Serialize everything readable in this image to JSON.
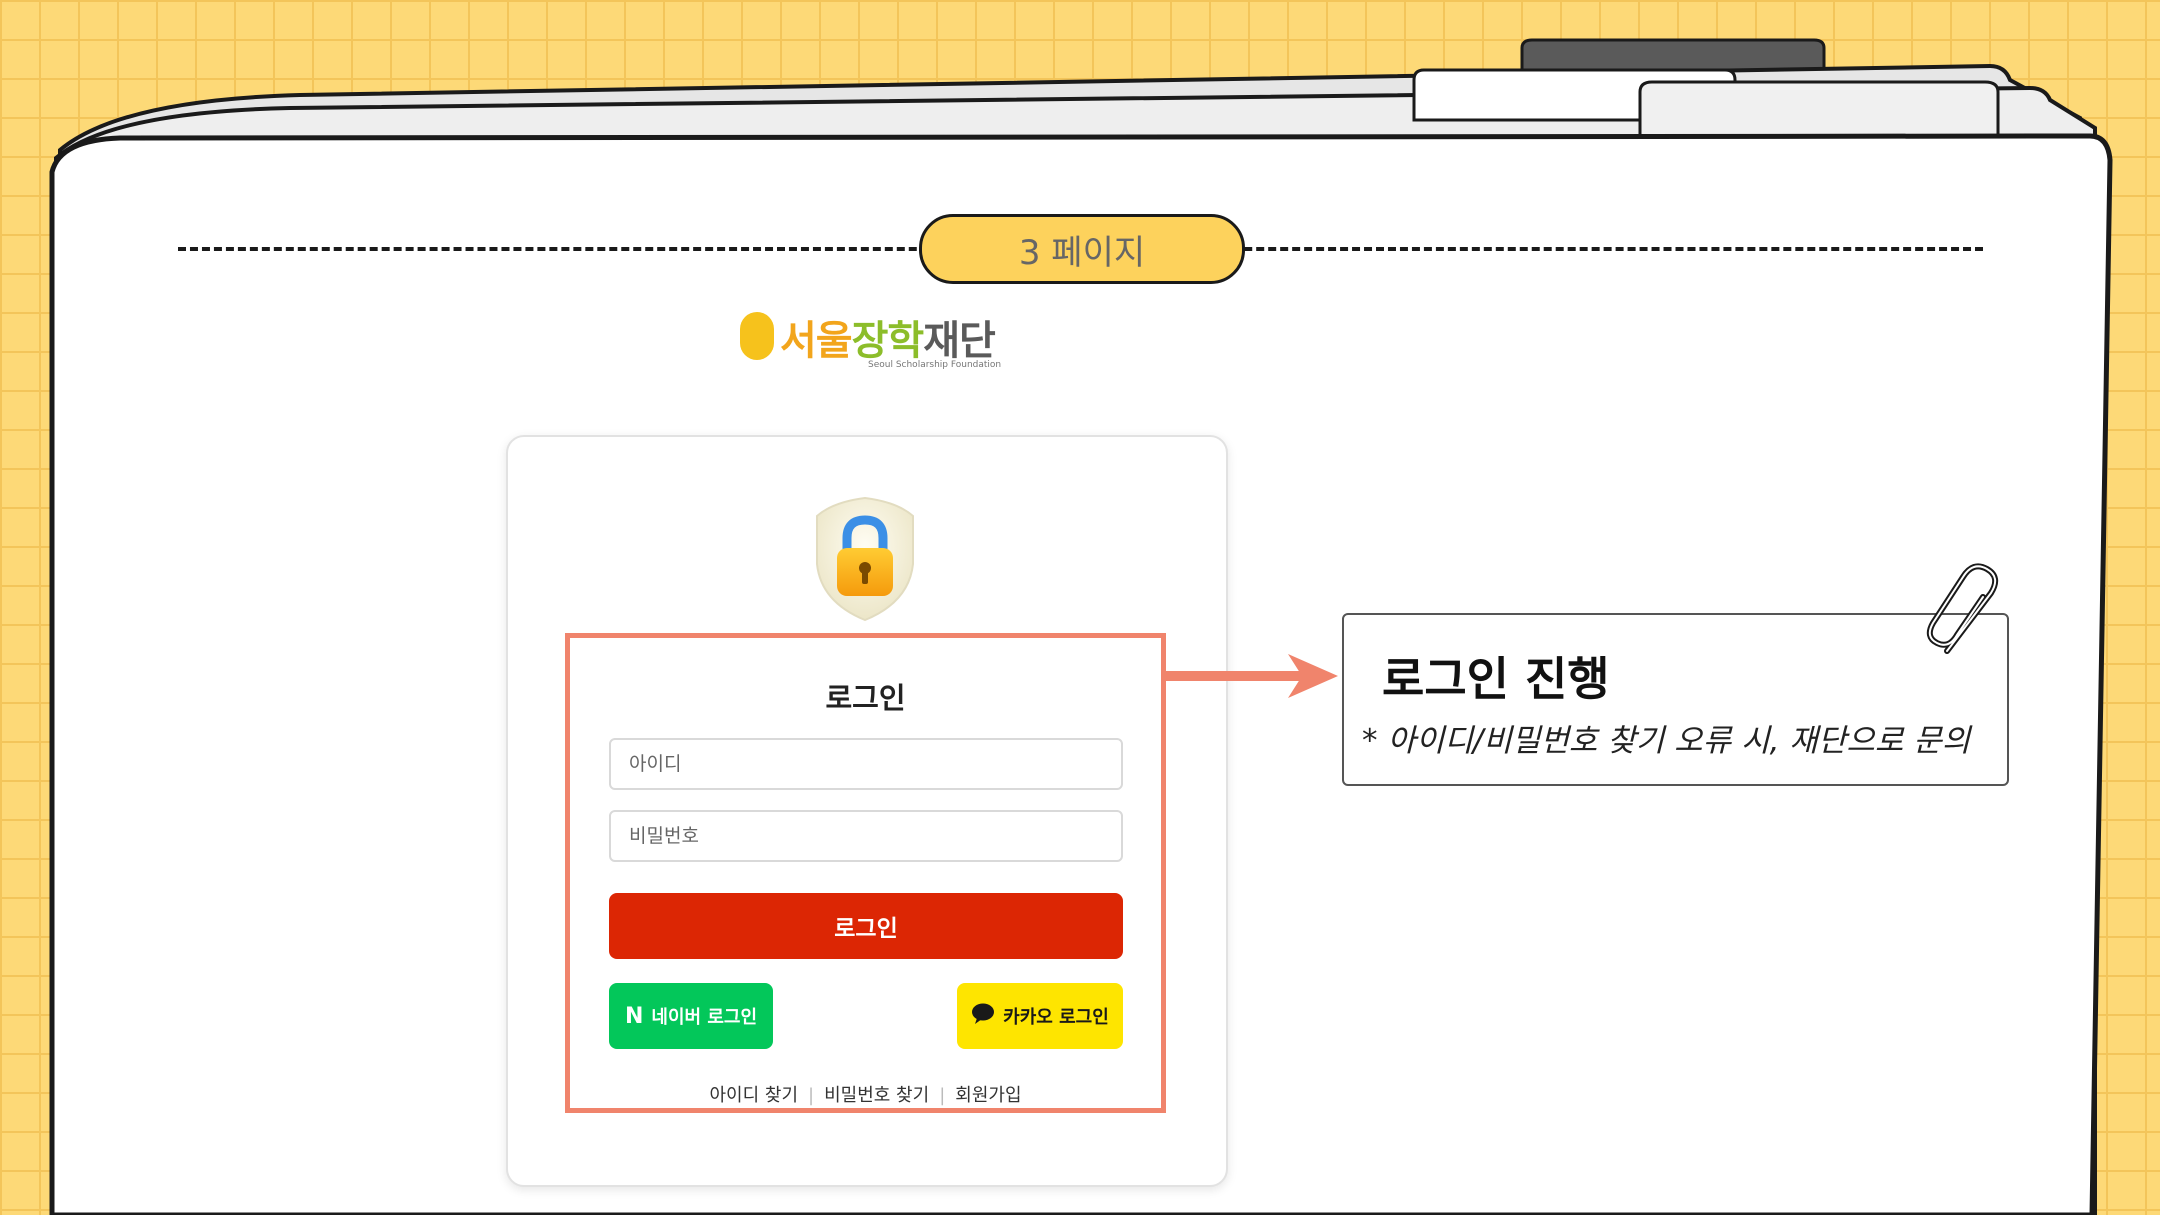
{
  "page_indicator": {
    "label": "3 페이지"
  },
  "logo": {
    "part1": "서울",
    "part2": "장학",
    "part3": "재단",
    "subtitle": "Seoul Scholarship Foundation"
  },
  "login_form": {
    "title": "로그인",
    "id_placeholder": "아이디",
    "password_placeholder": "비밀번호",
    "login_button": "로그인",
    "naver_mark": "N",
    "naver_button": "네이버 로그인",
    "kakao_button": "카카오 로그인",
    "links": {
      "find_id": "아이디 찾기",
      "find_password": "비밀번호 찾기",
      "signup": "회원가입"
    }
  },
  "annotation": {
    "title": "로그인 진행",
    "note": "* 아이디/비밀번호 찾기 오류 시, 재단으로 문의"
  },
  "colors": {
    "background": "#fdd977",
    "highlight": "#f0846c",
    "login_button": "#dc2604",
    "naver": "#03c75a",
    "kakao": "#fee500",
    "pill": "#fdd25c"
  },
  "icons": [
    "lock-icon",
    "naver-logo-icon",
    "kakao-chat-icon",
    "paperclip-icon",
    "arrow-right-icon"
  ]
}
